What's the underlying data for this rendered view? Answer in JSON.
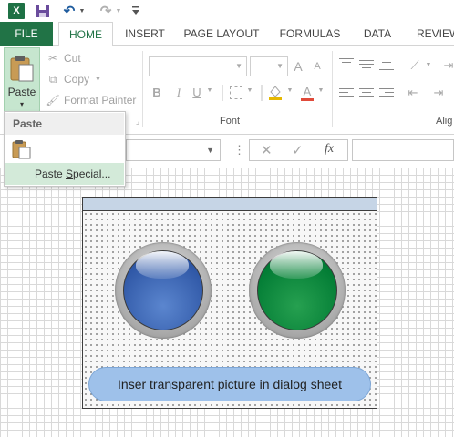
{
  "qat": {
    "app_logo": "X",
    "icons": [
      "excel-logo-icon",
      "save-icon",
      "undo-icon",
      "redo-icon",
      "customize-qat-icon"
    ]
  },
  "tabs": [
    {
      "label": "FILE"
    },
    {
      "label": "HOME"
    },
    {
      "label": "INSERT"
    },
    {
      "label": "PAGE LAYOUT"
    },
    {
      "label": "FORMULAS"
    },
    {
      "label": "DATA"
    },
    {
      "label": "REVIEW"
    }
  ],
  "ribbon": {
    "clipboard": {
      "paste_label": "Paste",
      "cut_label": "Cut",
      "copy_label": "Copy",
      "format_painter_label": "Format Painter"
    },
    "font_group_label": "Font",
    "alignment_group_label": "Alig",
    "font_buttons": {
      "bold": "B",
      "italic": "I",
      "underline": "U",
      "text_color": "A",
      "grow": "A",
      "shrink": "A"
    }
  },
  "paste_menu": {
    "header": "Paste",
    "special_prefix": "Paste ",
    "special_underlined": "S",
    "special_suffix": "pecial..."
  },
  "formula_bar": {
    "name_box_value": "",
    "cancel": "✕",
    "enter": "✓",
    "fx": "fx",
    "formula_value": ""
  },
  "dialog": {
    "button_text": "Inser transparent picture in dialog sheet",
    "knobs": [
      {
        "color": "#2d55a4"
      },
      {
        "color": "#007a33"
      }
    ]
  },
  "colors": {
    "accent": "#217346",
    "paste_highlight": "#c6e6cf",
    "dialog_title": "#c6d5e6",
    "pill": "#9ec1ea"
  }
}
